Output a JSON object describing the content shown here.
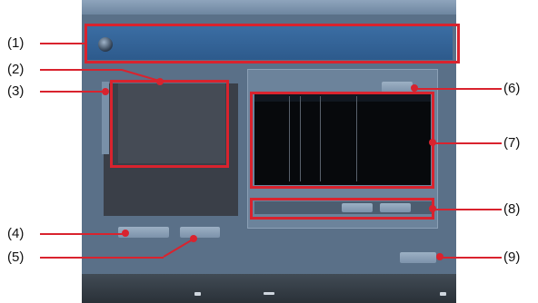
{
  "window": {
    "title": "",
    "header": {
      "label": "",
      "text": ""
    },
    "info": {
      "rows": [
        {
          "label": "",
          "value": ""
        },
        {
          "label": "",
          "value": ""
        },
        {
          "label": "",
          "value": ""
        },
        {
          "label": "",
          "value": ""
        }
      ]
    },
    "button_4": "",
    "button_5": "",
    "right_panel": {
      "title": "",
      "list_label": "",
      "bottom_text": ""
    },
    "button_6": "",
    "button_9": ""
  },
  "callouts": [
    "(1)",
    "(2)",
    "(3)",
    "(4)",
    "(5)",
    "(6)",
    "(7)",
    "(8)",
    "(9)"
  ],
  "colors": {
    "callout_red": "#d9232e",
    "header_blue": "#2d5a8c",
    "panel_bg": "#5a7088"
  }
}
